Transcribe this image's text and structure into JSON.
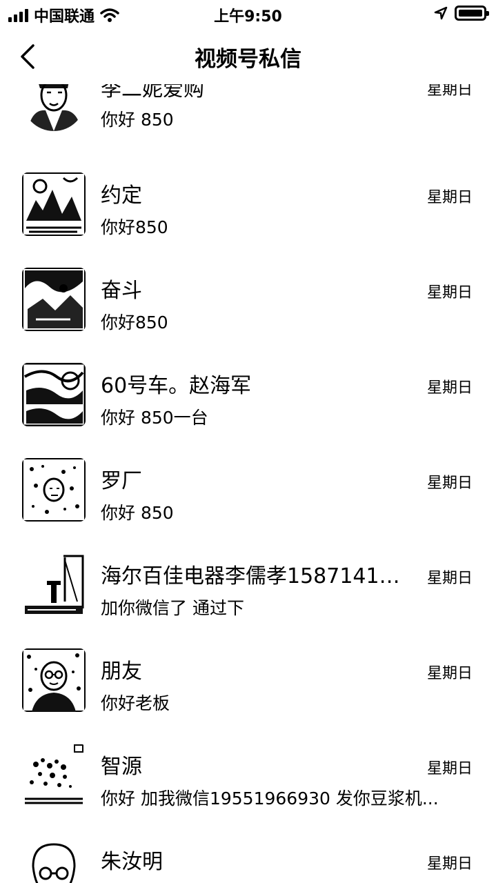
{
  "status_bar": {
    "carrier": "中国联通",
    "time": "上午9:50"
  },
  "nav": {
    "title": "视频号私信"
  },
  "conversations": [
    {
      "name": "李二妮爱购",
      "message": "你好 850",
      "time": "星期日",
      "avatar_icon": "portrait-photo"
    },
    {
      "name": "约定",
      "message": "你好850",
      "time": "星期日",
      "avatar_icon": "landscape-photo"
    },
    {
      "name": "奋斗",
      "message": "你好850",
      "time": "星期日",
      "avatar_icon": "landscape-photo"
    },
    {
      "name": "60号车。赵海军",
      "message": "你好 850一台",
      "time": "星期日",
      "avatar_icon": "people-photo"
    },
    {
      "name": "罗厂",
      "message": "你好 850",
      "time": "星期日",
      "avatar_icon": "texture-photo"
    },
    {
      "name": "海尔百佳电器李儒孝15871416...",
      "message": "加你微信了 通过下",
      "time": "星期日",
      "avatar_icon": "boat-photo"
    },
    {
      "name": "朋友",
      "message": "你好老板",
      "time": "星期日",
      "avatar_icon": "person-with-glasses-photo"
    },
    {
      "name": "智源",
      "message": "你好 加我微信19551966930 发你豆浆机...",
      "time": "星期日",
      "avatar_icon": "tree-photo"
    },
    {
      "name": "朱汝明",
      "message": "",
      "time": "星期日",
      "avatar_icon": "cartoon-face"
    }
  ]
}
